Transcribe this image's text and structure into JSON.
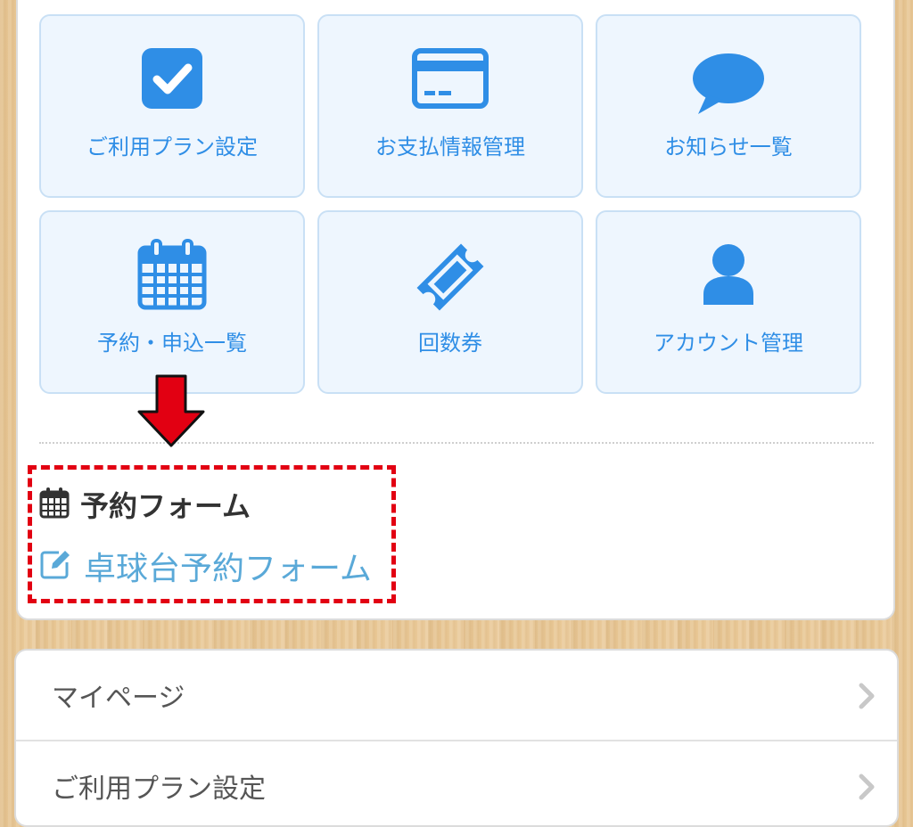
{
  "tiles": [
    {
      "label": "ご利用プラン設定",
      "icon": "checkbox-icon"
    },
    {
      "label": "お支払情報管理",
      "icon": "credit-card-icon"
    },
    {
      "label": "お知らせ一覧",
      "icon": "speech-bubble-icon"
    },
    {
      "label": "予約・申込一覧",
      "icon": "calendar-icon"
    },
    {
      "label": "回数券",
      "icon": "ticket-icon"
    },
    {
      "label": "アカウント管理",
      "icon": "user-icon"
    }
  ],
  "reservation_form": {
    "heading": "予約フォーム",
    "heading_icon": "calendar-icon",
    "link_label": "卓球台予約フォーム",
    "link_icon": "edit-icon"
  },
  "menu": {
    "items": [
      {
        "label": "マイページ"
      },
      {
        "label": "ご利用プラン設定"
      }
    ]
  },
  "colors": {
    "tile_icon": "#2f8ee6",
    "tile_background": "#eef6fe",
    "link": "#5aa9d8",
    "annotation": "#e20012"
  }
}
